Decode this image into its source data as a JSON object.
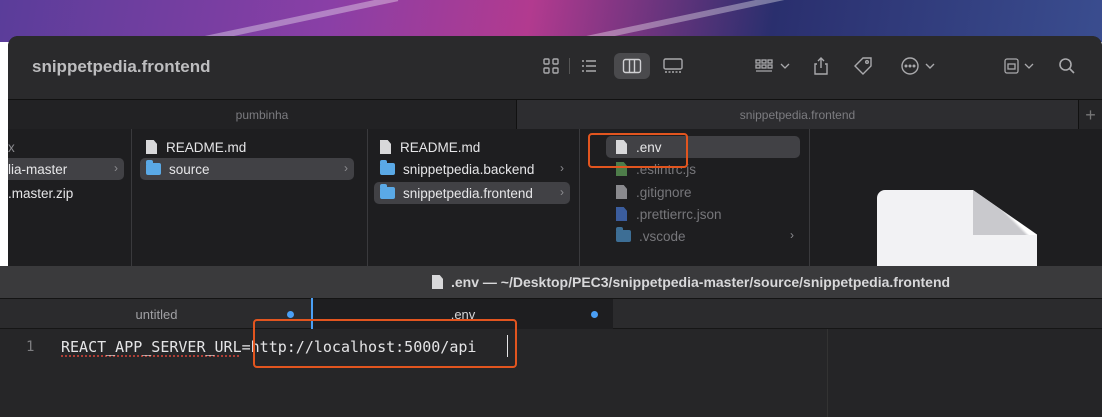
{
  "finder": {
    "title": "snippetpedia.frontend",
    "tabs": [
      "pumbinha",
      "snippetpedia.frontend"
    ],
    "columns": [
      {
        "items": [
          {
            "icon": "text",
            "label": "x"
          },
          {
            "icon": "text",
            "label": "lia-master"
          },
          {
            "icon": "text",
            "label": ".master.zip"
          }
        ]
      },
      {
        "items": [
          {
            "icon": "file",
            "label": "README.md"
          },
          {
            "icon": "folder",
            "label": "source"
          }
        ]
      },
      {
        "items": [
          {
            "icon": "file",
            "label": "README.md"
          },
          {
            "icon": "folder",
            "label": "snippetpedia.backend"
          },
          {
            "icon": "folder",
            "label": "snippetpedia.frontend"
          }
        ]
      },
      {
        "items": [
          {
            "icon": "file",
            "label": ".env"
          },
          {
            "icon": "file",
            "label": ".eslintrc.js"
          },
          {
            "icon": "file",
            "label": ".gitignore"
          },
          {
            "icon": "file",
            "label": ".prettierrc.json"
          },
          {
            "icon": "folder",
            "label": ".vscode"
          }
        ]
      }
    ]
  },
  "editor": {
    "title": ".env — ~/Desktop/PEC3/snippetpedia-master/source/snippetpedia.frontend",
    "tabs": [
      "untitled",
      ".env"
    ],
    "line_number": "1",
    "code_key": "REACT_APP_SERVER_URL",
    "code_eq": "=",
    "code_value": "http://localhost:5000/api"
  },
  "colors": {
    "highlight": "#e2551f",
    "accent": "#4a9ff5"
  }
}
